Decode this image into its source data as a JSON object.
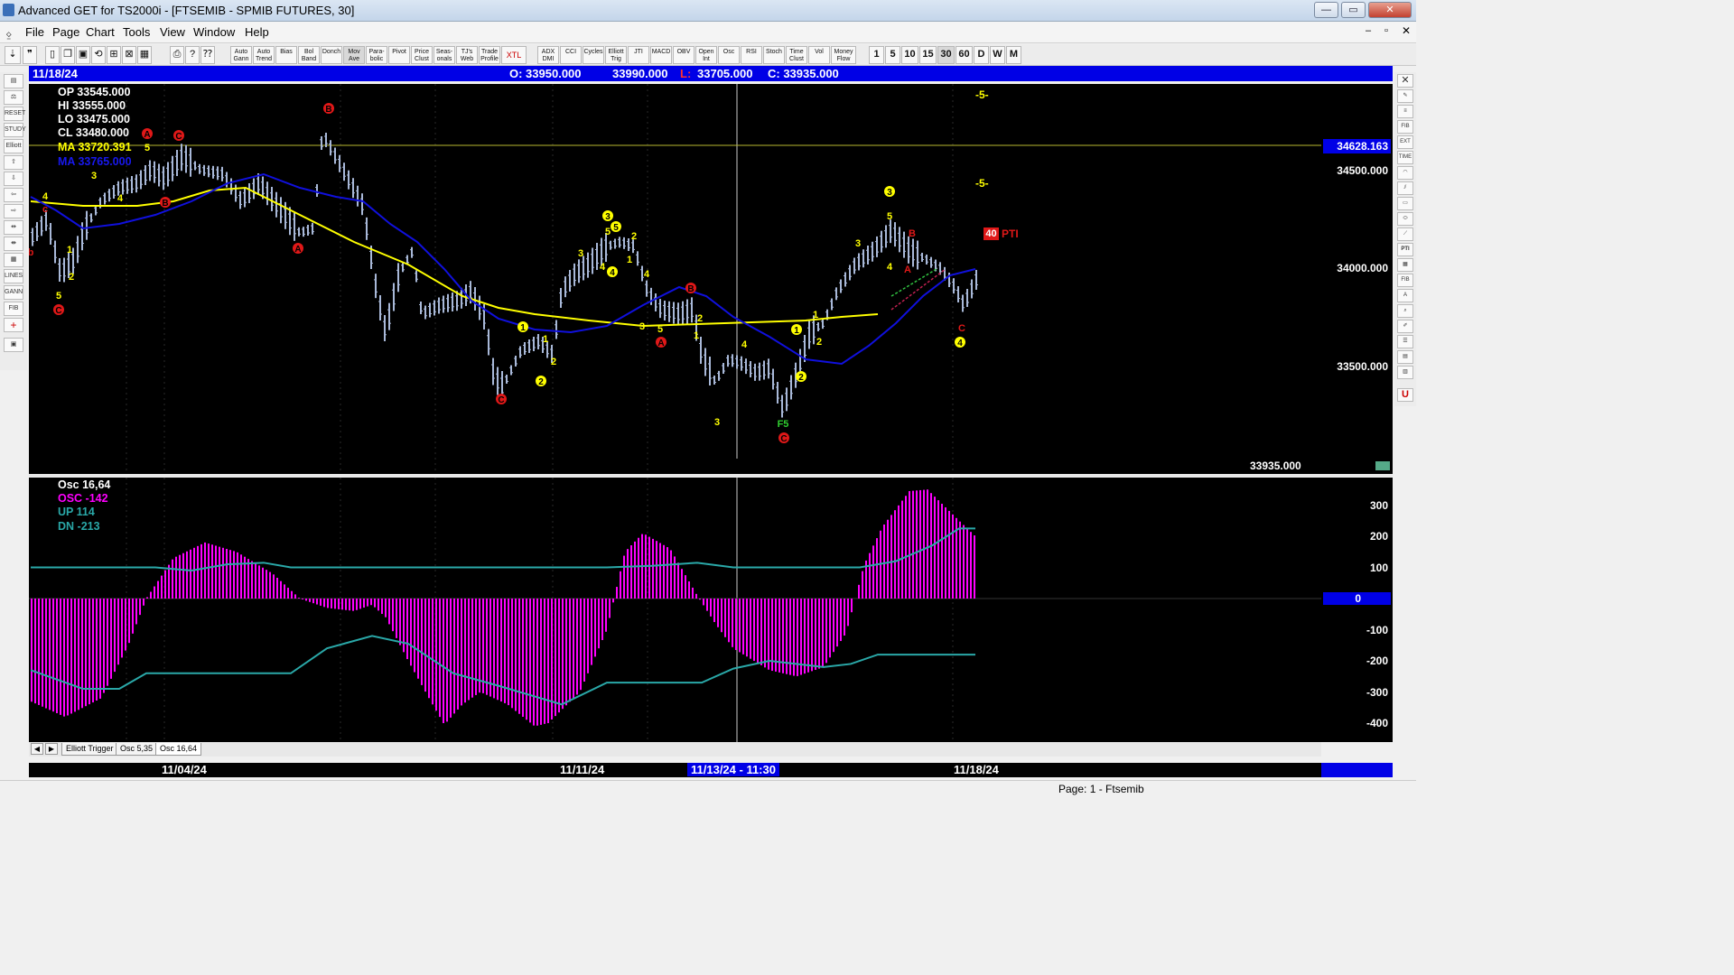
{
  "window": {
    "title": "Advanced GET for TS2000i - [FTSEMIB - SPMIB FUTURES, 30]",
    "min_label": "—",
    "max_label": "▭",
    "close_label": "✕"
  },
  "menu": [
    "File",
    "Page",
    "Chart",
    "Tools",
    "View",
    "Window",
    "Help"
  ],
  "toolbar": {
    "study_buttons": [
      "Auto Gann",
      "Auto Trend",
      "Bias",
      "Bol Band",
      "Donch",
      "Mov Ave",
      "Para-bolic",
      "Pivot",
      "Price Clust",
      "Seas-onals",
      "TJ's Web",
      "Trade Profile",
      "XTL",
      "ADX DMI",
      "CCI",
      "Cycles",
      "Elliott Trig",
      "JTI",
      "MACD",
      "OBV",
      "Open Int",
      "Osc",
      "RSI",
      "Stoch",
      "Time Clust",
      "Vol",
      "Money Flow"
    ],
    "intervals": [
      "1",
      "5",
      "10",
      "15",
      "30",
      "60",
      "D",
      "W",
      "M"
    ],
    "active_interval": "30"
  },
  "infobar": {
    "date": "11/18/24",
    "open": "O: 33950.000",
    "high": "33990.000",
    "low_prefix": "L:",
    "low": "33705.000",
    "close": "C: 33935.000"
  },
  "main_stats": {
    "op": "OP  33545.000",
    "hi": "HI   33555.000",
    "lo": "LO  33475.000",
    "cl": "CL  33480.000",
    "ma1": "MA  33720.391",
    "ma2": "MA  33765.000"
  },
  "main_axis": {
    "labels": [
      "34500.000",
      "34000.000",
      "33500.000"
    ],
    "cursor_price": "34628.163",
    "last_price": "33935.000",
    "colors": {
      "ma_yellow": "#ffff00",
      "ma_blue": "#1010dd",
      "bars": "#a8b8d8",
      "wave_red": "#e01818",
      "wave_yellow": "#ffff00"
    }
  },
  "markers": {
    "five_top_1": "-5-",
    "five_top_2": "-5-",
    "pti_value": "40",
    "pti_label": "PTI"
  },
  "osc_stats": {
    "name": "Osc 16,64",
    "osc": "OSC -142",
    "up": "UP   114",
    "dn": "DN   -213"
  },
  "osc_axis": {
    "labels": [
      "300",
      "200",
      "100",
      "0",
      "-100",
      "-200",
      "-300",
      "-400"
    ],
    "colors": {
      "histogram": "#ff00ff",
      "bands": "#2aa8a8"
    }
  },
  "tabs": [
    "Elliott Trigger",
    "Osc 5,35",
    "Osc 16,64"
  ],
  "active_tab": "Osc 16,64",
  "dates": [
    "11/04/24",
    "11/11/24",
    "11/13/24 - 11:30",
    "11/18/24"
  ],
  "status": "Page: 1 - Ftsemib"
}
